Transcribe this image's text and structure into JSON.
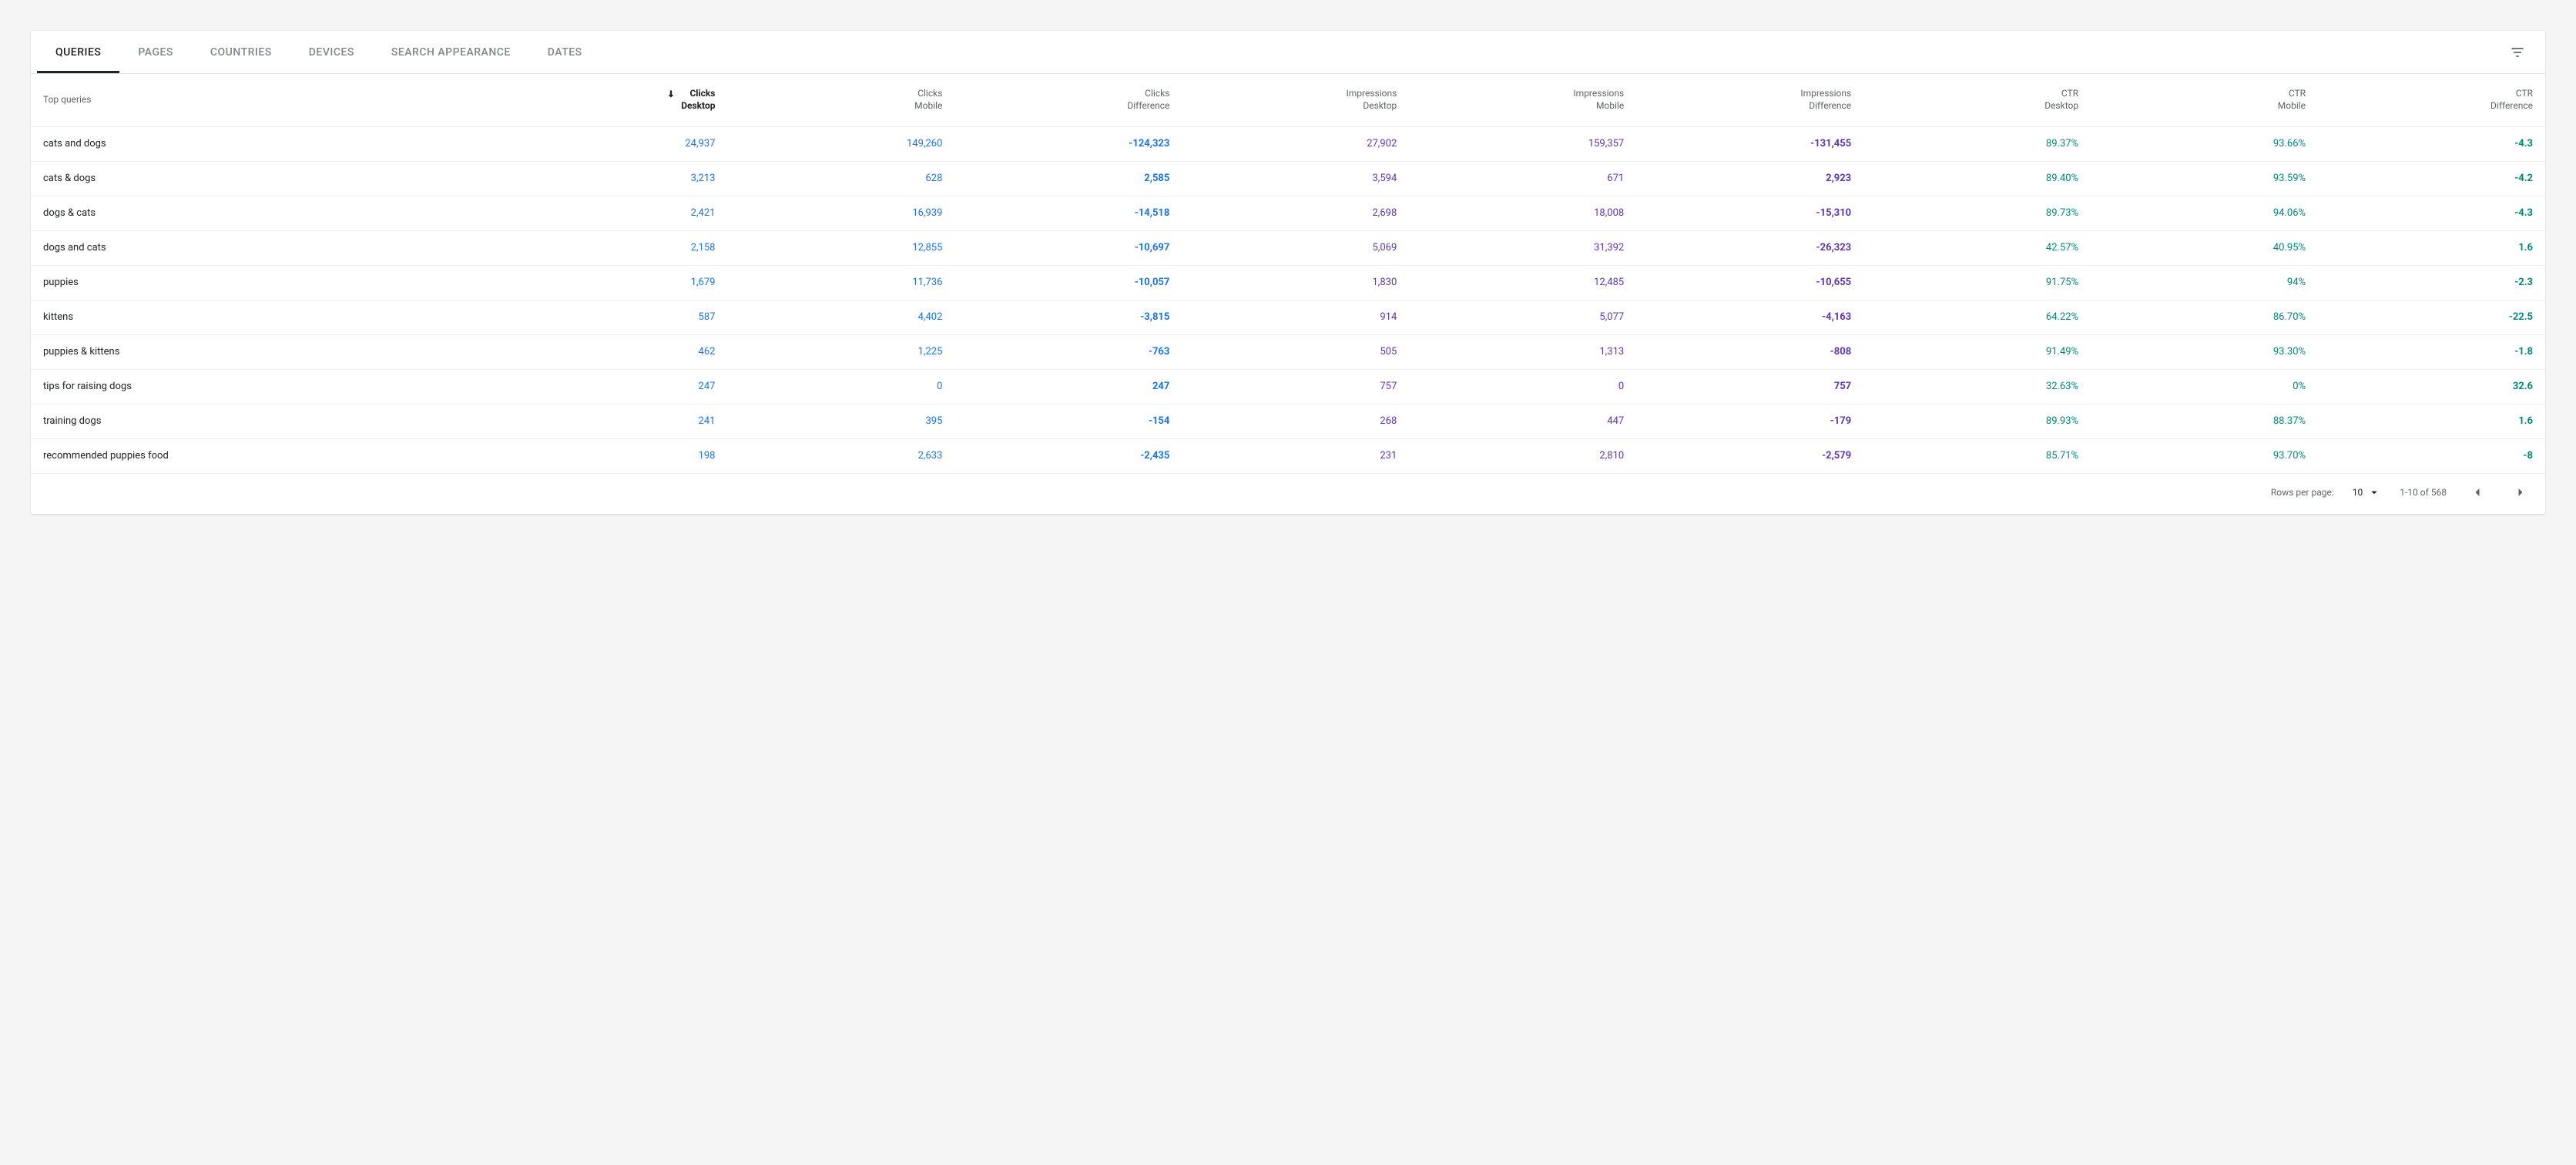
{
  "tabs": {
    "items": [
      {
        "label": "Queries",
        "active": true
      },
      {
        "label": "Pages",
        "active": false
      },
      {
        "label": "Countries",
        "active": false
      },
      {
        "label": "Devices",
        "active": false
      },
      {
        "label": "Search appearance",
        "active": false
      },
      {
        "label": "Dates",
        "active": false
      }
    ]
  },
  "table": {
    "query_header": "Top queries",
    "columns": [
      {
        "line1": "Clicks",
        "line2": "Desktop",
        "metric": "clicks",
        "sorted_desc": true
      },
      {
        "line1": "Clicks",
        "line2": "Mobile",
        "metric": "clicks"
      },
      {
        "line1": "Clicks",
        "line2": "Difference",
        "metric": "clicks",
        "diff": true
      },
      {
        "line1": "Impressions",
        "line2": "Desktop",
        "metric": "impr"
      },
      {
        "line1": "Impressions",
        "line2": "Mobile",
        "metric": "impr"
      },
      {
        "line1": "Impressions",
        "line2": "Difference",
        "metric": "impr",
        "diff": true
      },
      {
        "line1": "CTR",
        "line2": "Desktop",
        "metric": "ctr"
      },
      {
        "line1": "CTR",
        "line2": "Mobile",
        "metric": "ctr"
      },
      {
        "line1": "CTR",
        "line2": "Difference",
        "metric": "ctr",
        "diff": true
      }
    ],
    "rows": [
      {
        "query": "cats and dogs",
        "cells": [
          "24,937",
          "149,260",
          "-124,323",
          "27,902",
          "159,357",
          "-131,455",
          "89.37%",
          "93.66%",
          "-4.3"
        ]
      },
      {
        "query": "cats & dogs",
        "cells": [
          "3,213",
          "628",
          "2,585",
          "3,594",
          "671",
          "2,923",
          "89.40%",
          "93.59%",
          "-4.2"
        ]
      },
      {
        "query": "dogs & cats",
        "cells": [
          "2,421",
          "16,939",
          "-14,518",
          "2,698",
          "18,008",
          "-15,310",
          "89.73%",
          "94.06%",
          "-4.3"
        ]
      },
      {
        "query": "dogs and cats",
        "cells": [
          "2,158",
          "12,855",
          "-10,697",
          "5,069",
          "31,392",
          "-26,323",
          "42.57%",
          "40.95%",
          "1.6"
        ]
      },
      {
        "query": "puppies",
        "cells": [
          "1,679",
          "11,736",
          "-10,057",
          "1,830",
          "12,485",
          "-10,655",
          "91.75%",
          "94%",
          "-2.3"
        ]
      },
      {
        "query": "kittens",
        "cells": [
          "587",
          "4,402",
          "-3,815",
          "914",
          "5,077",
          "-4,163",
          "64.22%",
          "86.70%",
          "-22.5"
        ]
      },
      {
        "query": "puppies & kittens",
        "cells": [
          "462",
          "1,225",
          "-763",
          "505",
          "1,313",
          "-808",
          "91.49%",
          "93.30%",
          "-1.8"
        ]
      },
      {
        "query": "tips for raising dogs",
        "cells": [
          "247",
          "0",
          "247",
          "757",
          "0",
          "757",
          "32.63%",
          "0%",
          "32.6"
        ]
      },
      {
        "query": "training dogs",
        "cells": [
          "241",
          "395",
          "-154",
          "268",
          "447",
          "-179",
          "89.93%",
          "88.37%",
          "1.6"
        ]
      },
      {
        "query": "recommended puppies food",
        "cells": [
          "198",
          "2,633",
          "-2,435",
          "231",
          "2,810",
          "-2,579",
          "85.71%",
          "93.70%",
          "-8"
        ]
      }
    ]
  },
  "footer": {
    "rows_per_page_label": "Rows per page:",
    "rows_per_page_value": "10",
    "range_label": "1-10 of 568"
  }
}
